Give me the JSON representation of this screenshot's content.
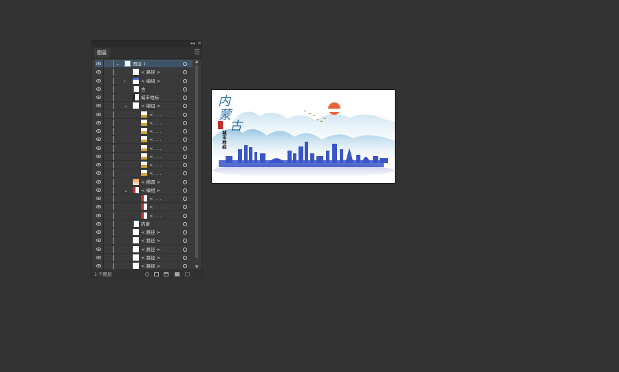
{
  "panel": {
    "tab_label": "图层",
    "collapse_glyph": "◂◂",
    "close_glyph": "✕",
    "footer_label": "1 个图层"
  },
  "layers": [
    {
      "name": "图层 1",
      "indent": 0,
      "toggle": "open",
      "selected": true,
      "thumb": "layer"
    },
    {
      "name": "< 路径 >",
      "indent": 1,
      "toggle": "",
      "thumb": "white"
    },
    {
      "name": "< 编组 >",
      "indent": 1,
      "toggle": "closed",
      "thumb": "line"
    },
    {
      "name": "古",
      "indent": 1,
      "toggle": "",
      "thumb": "text"
    },
    {
      "name": "城市地标",
      "indent": 1,
      "toggle": "",
      "thumb": "text2"
    },
    {
      "name": "< 编组 >",
      "indent": 1,
      "toggle": "open",
      "thumb": "white"
    },
    {
      "name": "< . . .",
      "indent": 2,
      "toggle": "",
      "thumb": "gold"
    },
    {
      "name": "< . . .",
      "indent": 2,
      "toggle": "",
      "thumb": "gold"
    },
    {
      "name": "< . . .",
      "indent": 2,
      "toggle": "",
      "thumb": "gold"
    },
    {
      "name": "< . . .",
      "indent": 2,
      "toggle": "",
      "thumb": "gold"
    },
    {
      "name": "< . . .",
      "indent": 2,
      "toggle": "",
      "thumb": "gold"
    },
    {
      "name": "< . . .",
      "indent": 2,
      "toggle": "",
      "thumb": "gold"
    },
    {
      "name": "< . . .",
      "indent": 2,
      "toggle": "",
      "thumb": "gold"
    },
    {
      "name": "< . . .",
      "indent": 2,
      "toggle": "",
      "thumb": "gold"
    },
    {
      "name": "< 椭圆 >",
      "indent": 1,
      "toggle": "",
      "thumb": "orange"
    },
    {
      "name": "< 编组 >",
      "indent": 1,
      "toggle": "open",
      "thumb": "red"
    },
    {
      "name": "< . . .",
      "indent": 2,
      "toggle": "",
      "thumb": "red"
    },
    {
      "name": "< . . .",
      "indent": 2,
      "toggle": "",
      "thumb": "red"
    },
    {
      "name": "< . . .",
      "indent": 2,
      "toggle": "",
      "thumb": "red"
    },
    {
      "name": "内蒙",
      "indent": 1,
      "toggle": "",
      "thumb": "text"
    },
    {
      "name": "< 路径 >",
      "indent": 1,
      "toggle": "",
      "thumb": "white"
    },
    {
      "name": "< 路径 >",
      "indent": 1,
      "toggle": "",
      "thumb": "white"
    },
    {
      "name": "< 路径 >",
      "indent": 1,
      "toggle": "",
      "thumb": "white"
    },
    {
      "name": "< 路径 >",
      "indent": 1,
      "toggle": "",
      "thumb": "white"
    },
    {
      "name": "< 路径 >",
      "indent": 1,
      "toggle": "",
      "thumb": "white"
    }
  ],
  "artwork": {
    "title_chars": [
      "内",
      "蒙",
      "古"
    ],
    "subtitle": "城市地标",
    "colors": {
      "mountain": "#a9cfe6",
      "city": "#3a55c8",
      "sun": "#e8653a",
      "title": "#2a6fa8"
    }
  }
}
